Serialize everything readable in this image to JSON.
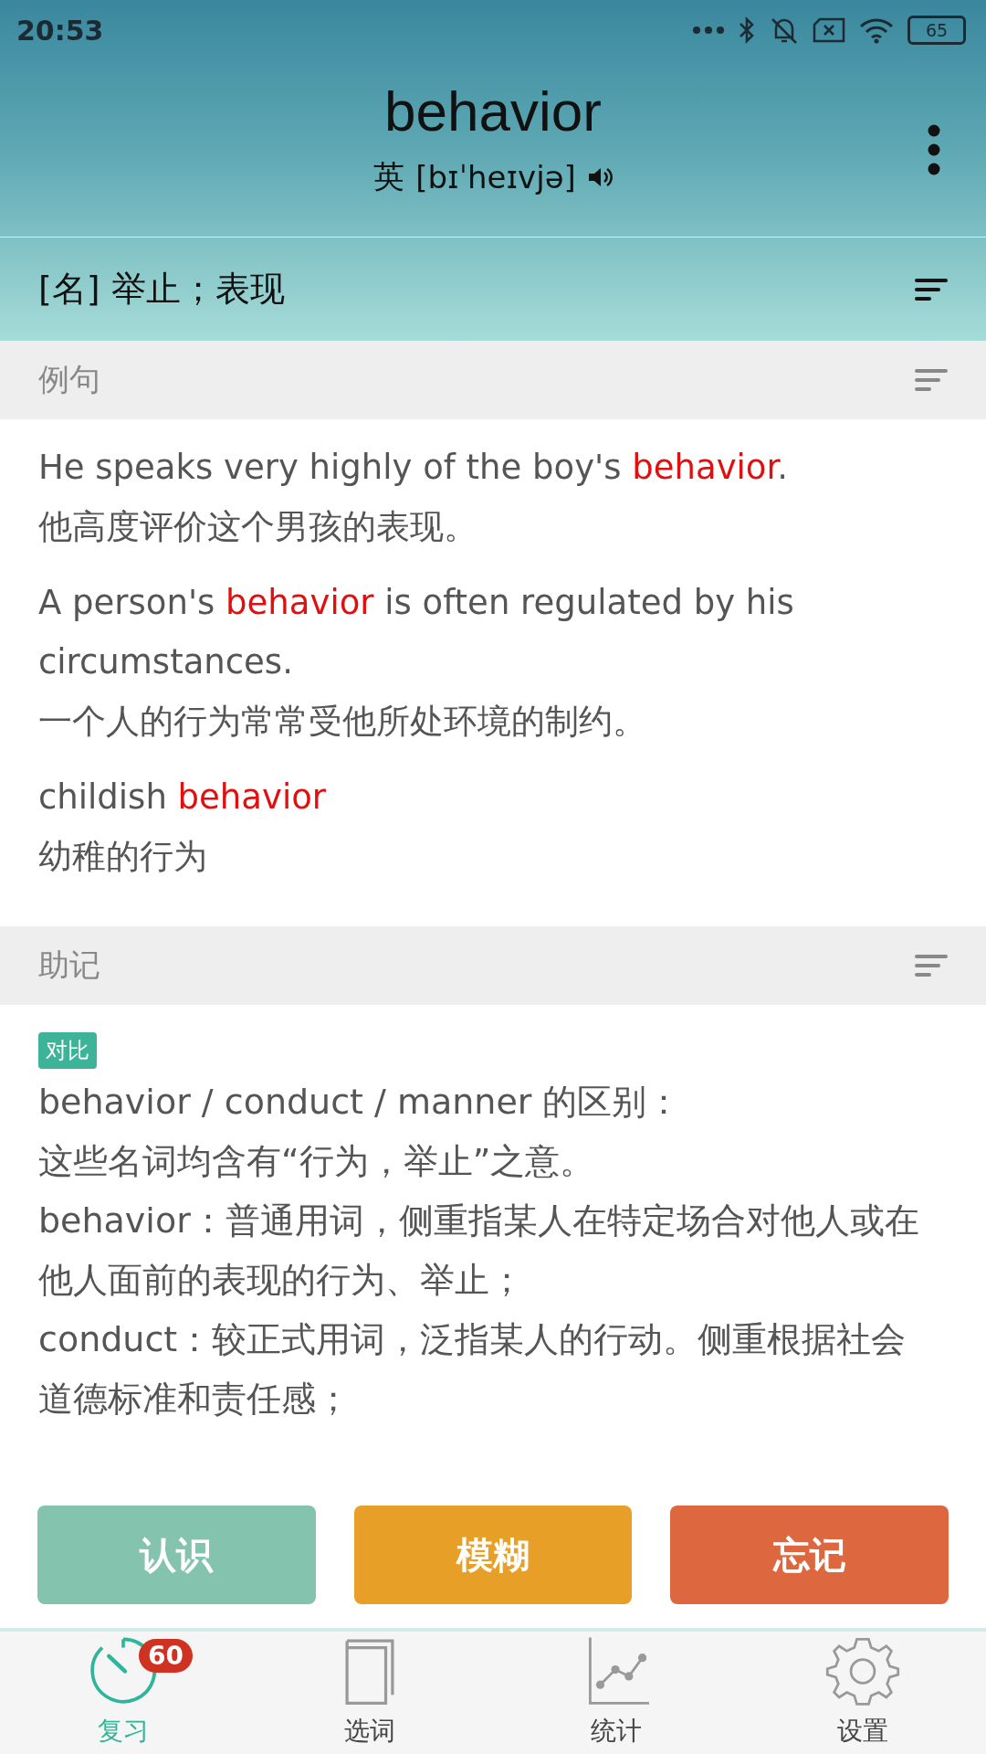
{
  "status_bar": {
    "time": "20:53",
    "battery": "65"
  },
  "header": {
    "word": "behavior",
    "accent": "英",
    "phonetic": "[bɪˈheɪvjə]"
  },
  "definition": "[名] 举止；表现",
  "examples_section": {
    "title": "例句",
    "examples": [
      {
        "english": {
          "before": "He speaks very highly of the boy's ",
          "keyword": "behavior",
          "after": "."
        },
        "chinese": "他高度评价这个男孩的表现。"
      },
      {
        "english": {
          "before": "A person's ",
          "keyword": "behavior",
          "after": " is often regulated by his circumstances."
        },
        "chinese": "一个人的行为常常受他所处环境的制约。"
      },
      {
        "english": {
          "before": "childish ",
          "keyword": "behavior"
        },
        "chinese": "幼稚的行为"
      }
    ]
  },
  "mnemonic_section": {
    "title": "助记",
    "tag": "对比",
    "lines": [
      "behavior / conduct / manner 的区别：",
      "这些名词均含有“行为，举止”之意。",
      "behavior：普通用词，侧重指某人在特定场合对他人或在他人面前的表现的行为、举止；",
      "conduct：较正式用词，泛指某人的行动。侧重根据社会道德标准和责任感；"
    ]
  },
  "answer_buttons": [
    {
      "label": "认识",
      "kind": "know"
    },
    {
      "label": "模糊",
      "kind": "vague"
    },
    {
      "label": "忘记",
      "kind": "forget"
    }
  ],
  "bottom_nav": [
    {
      "label": "复习",
      "kind": "review",
      "selected": true,
      "badge": "60"
    },
    {
      "label": "选词",
      "kind": "words",
      "selected": false
    },
    {
      "label": "统计",
      "kind": "stats",
      "selected": false
    },
    {
      "label": "设置",
      "kind": "settings",
      "selected": false
    }
  ]
}
